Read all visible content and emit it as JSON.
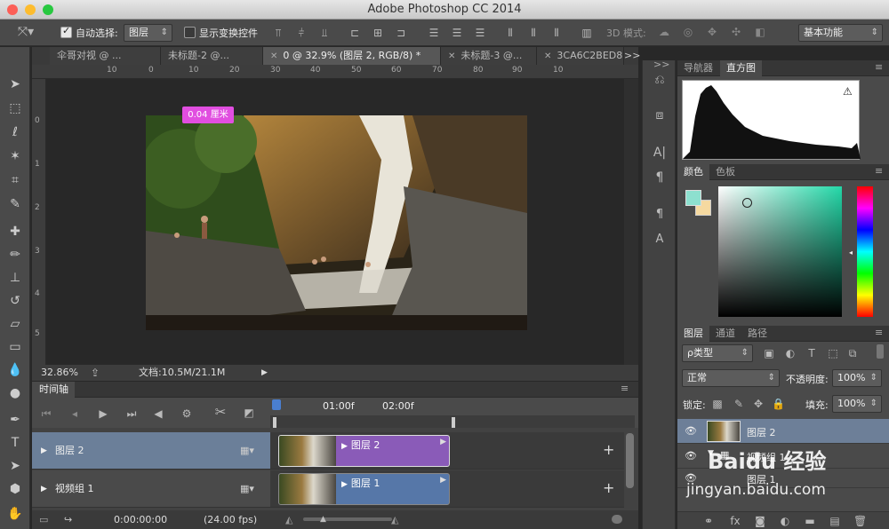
{
  "window": {
    "title": "Adobe Photoshop CC 2014"
  },
  "options_bar": {
    "auto_select_label": "自动选择:",
    "auto_select_value": "图层",
    "show_transform_label": "显示变换控件",
    "mode_3d_label": "3D 模式:",
    "workspace": "基本功能"
  },
  "doc_tabs": [
    {
      "label": "伞哥对视 @ ..."
    },
    {
      "label": "未标题-2 @..."
    },
    {
      "label": "0 @ 32.9% (图层 2, RGB/8) *"
    },
    {
      "label": "未标题-3 @..."
    },
    {
      "label": "3CA6C2BED86"
    }
  ],
  "tab_overflow": ">>",
  "ruler_h": [
    "10",
    "0",
    "10",
    "20",
    "30",
    "40",
    "50",
    "60",
    "70",
    "80",
    "90",
    "10"
  ],
  "ruler_v": [
    "0",
    "1",
    "2",
    "3",
    "4",
    "5"
  ],
  "tooltip": "0.04 厘米",
  "status": {
    "zoom": "32.86%",
    "doc": "文档:10.5M/21.1M"
  },
  "timeline": {
    "title": "时间轴",
    "time_marks": [
      "01:00f",
      "02:00f"
    ],
    "tracks": [
      {
        "name": "图层 2",
        "clip": "图层 2",
        "selected": true
      },
      {
        "name": "视频组 1",
        "clip": "图层 1",
        "selected": false
      }
    ],
    "timecode": "0:00:00:00",
    "fps": "(24.00 fps)"
  },
  "panels": {
    "nav_tabs": [
      "导航器",
      "直方图"
    ],
    "color_tabs": [
      "颜色",
      "色板"
    ],
    "layer_tabs": [
      "图层",
      "通道",
      "路径"
    ],
    "filter_kind": "ρ类型",
    "blend_mode": "正常",
    "opacity_label": "不透明度:",
    "opacity": "100%",
    "lock_label": "锁定:",
    "fill_label": "填充:",
    "fill": "100%",
    "layers": [
      {
        "name": "图层 2"
      },
      {
        "name": "视频组 1"
      },
      {
        "name": "图层 1"
      }
    ]
  },
  "watermark": {
    "brand": "Baidu 经验",
    "url": "jingyan.baidu.com"
  }
}
